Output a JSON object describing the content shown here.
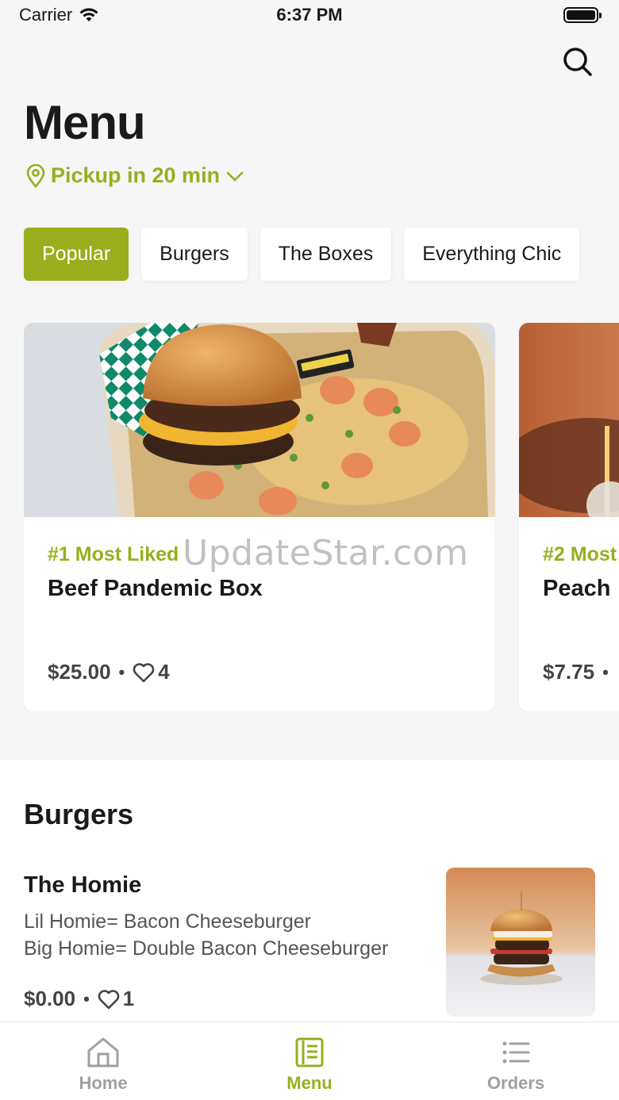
{
  "status": {
    "carrier": "Carrier",
    "time": "6:37 PM"
  },
  "header": {
    "title": "Menu",
    "pickup_label": "Pickup in 20 min"
  },
  "categories": [
    {
      "label": "Popular",
      "active": true
    },
    {
      "label": "Burgers",
      "active": false
    },
    {
      "label": "The Boxes",
      "active": false
    },
    {
      "label": "Everything Chic",
      "active": false
    }
  ],
  "popular": [
    {
      "rank": "#1 Most Liked",
      "name": "Beef Pandemic Box",
      "price": "$25.00",
      "likes": "4"
    },
    {
      "rank": "#2 Most",
      "name": "Peach",
      "price": "$7.75",
      "likes": ""
    }
  ],
  "watermark": "UpdateStar.com",
  "burgers": {
    "title": "Burgers",
    "items": [
      {
        "name": "The Homie",
        "desc_line1": "Lil Homie= Bacon Cheeseburger",
        "desc_line2": "Big Homie= Double Bacon Cheeseburger",
        "price": "$0.00",
        "likes": "1"
      }
    ]
  },
  "tabbar": {
    "items": [
      {
        "label": "Home",
        "icon": "home-icon",
        "active": false
      },
      {
        "label": "Menu",
        "icon": "menu-book-icon",
        "active": true
      },
      {
        "label": "Orders",
        "icon": "list-icon",
        "active": false
      }
    ]
  },
  "colors": {
    "accent": "#9aad1d",
    "background": "#f6f6f6"
  }
}
